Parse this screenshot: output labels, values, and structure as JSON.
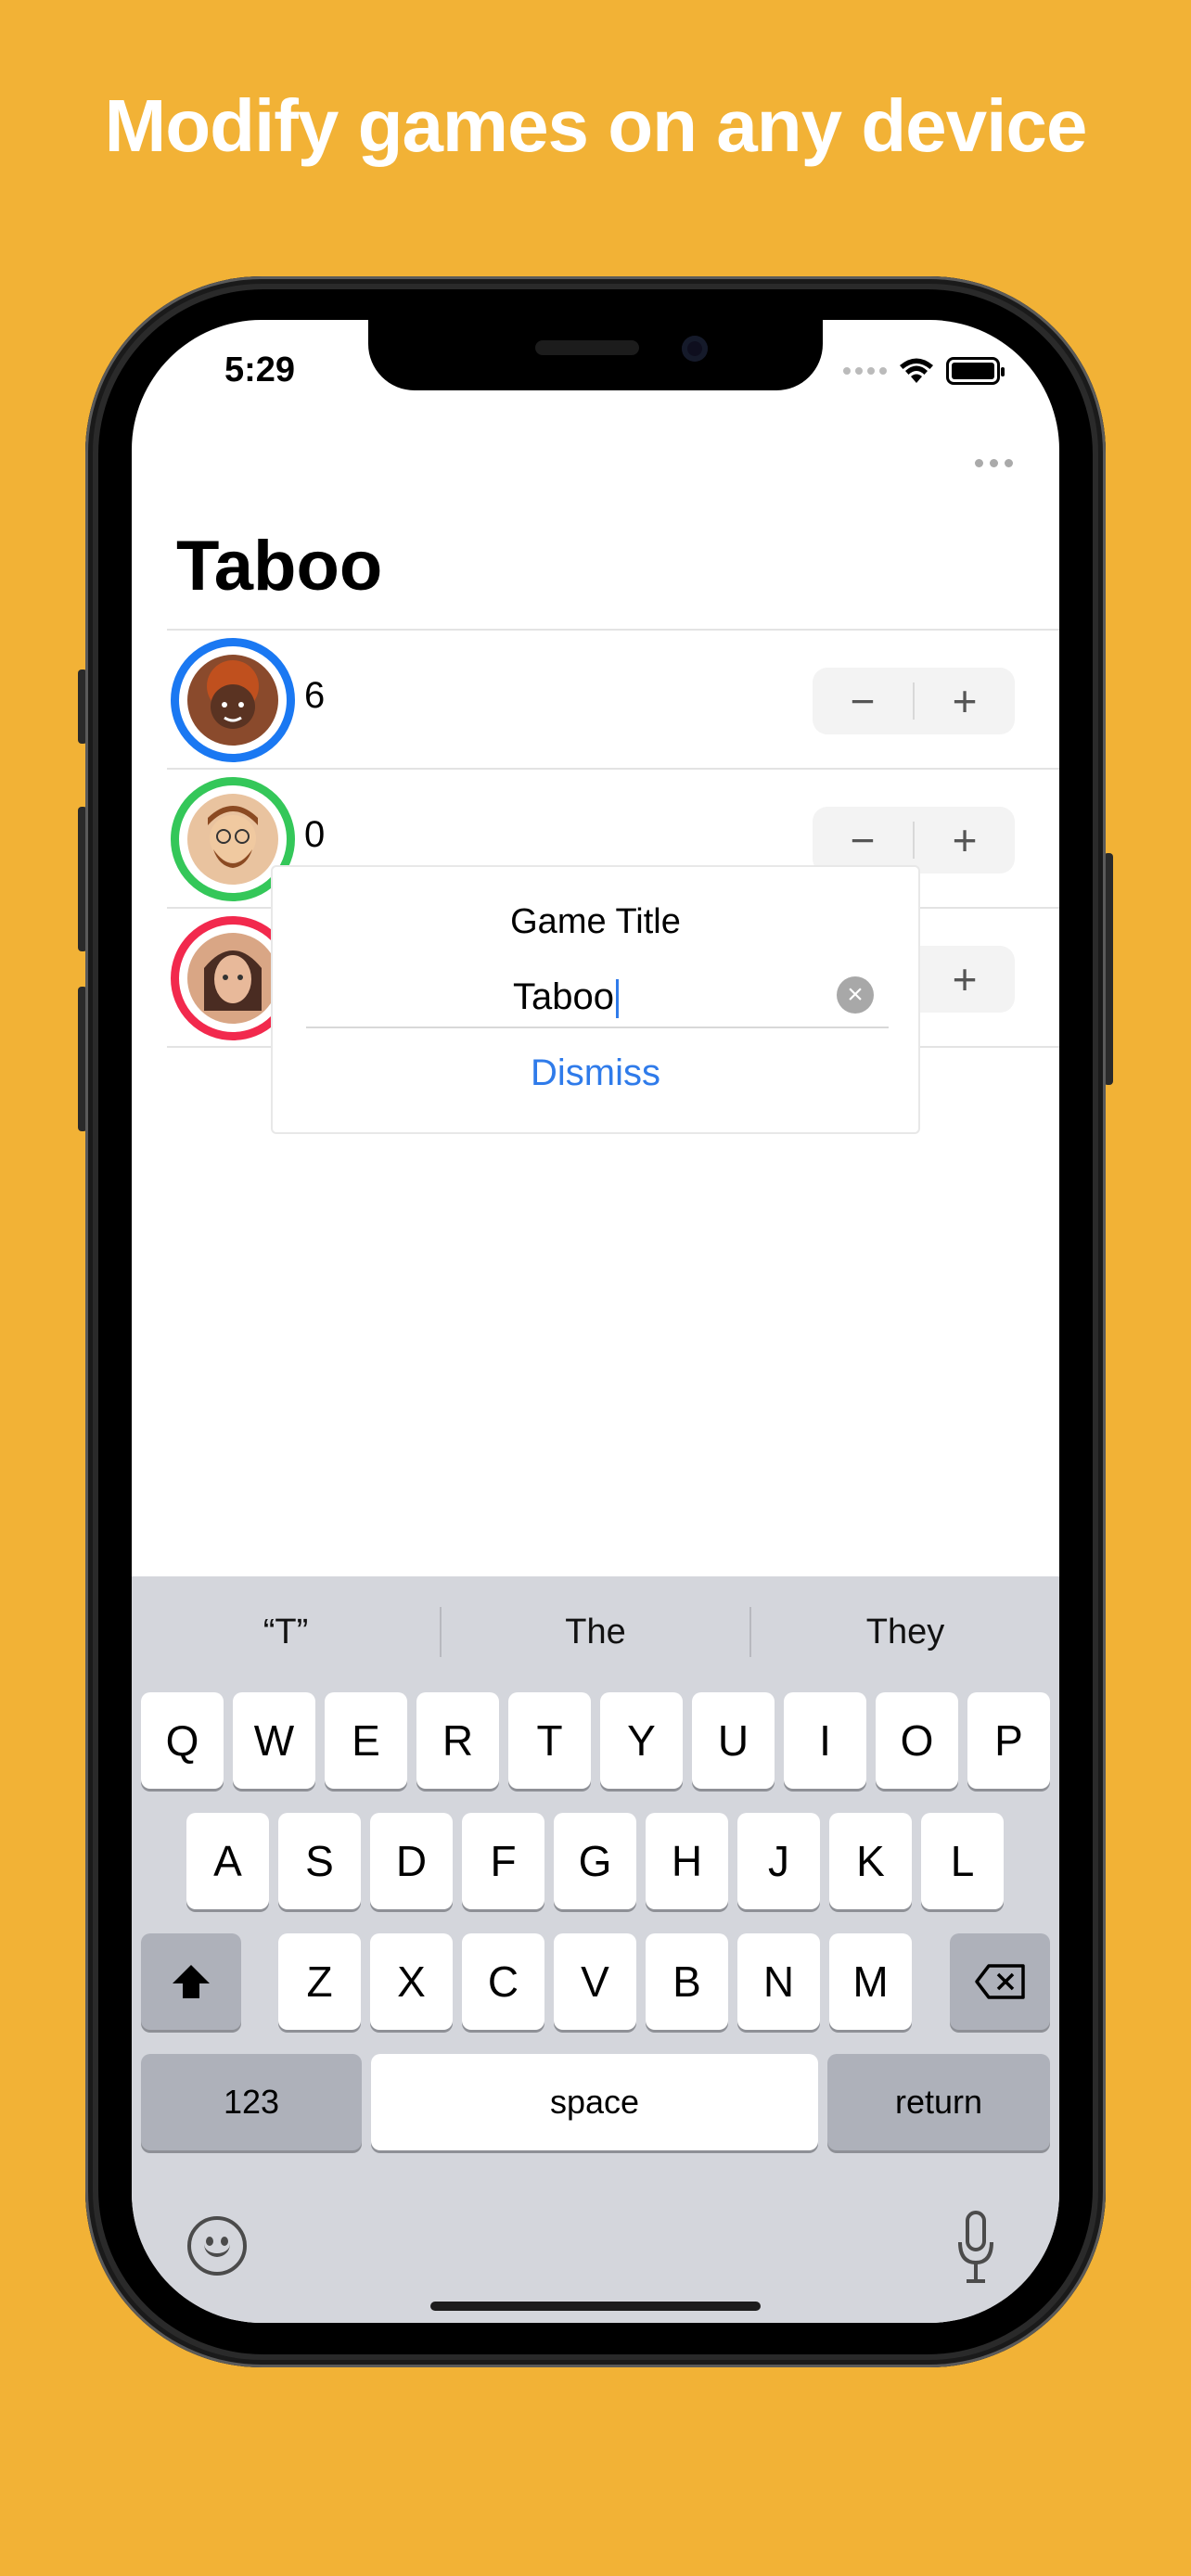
{
  "headline": "Modify games on any device",
  "status_bar": {
    "time": "5:29"
  },
  "nav": {
    "title": "Taboo"
  },
  "players": [
    {
      "score": "6",
      "ring_color": "#1a78f2"
    },
    {
      "score": "0",
      "ring_color": "#34c759"
    },
    {
      "score": "",
      "ring_color": "#f2294d"
    }
  ],
  "stepper": {
    "minus": "−",
    "plus": "+"
  },
  "alert": {
    "title": "Game Title",
    "input_value": "Taboo",
    "action": "Dismiss"
  },
  "keyboard": {
    "suggestions": [
      "“T”",
      "The",
      "They"
    ],
    "row1": [
      "Q",
      "W",
      "E",
      "R",
      "T",
      "Y",
      "U",
      "I",
      "O",
      "P"
    ],
    "row2": [
      "A",
      "S",
      "D",
      "F",
      "G",
      "H",
      "J",
      "K",
      "L"
    ],
    "row3": [
      "Z",
      "X",
      "C",
      "V",
      "B",
      "N",
      "M"
    ],
    "numbers_key": "123",
    "space_key": "space",
    "return_key": "return"
  }
}
